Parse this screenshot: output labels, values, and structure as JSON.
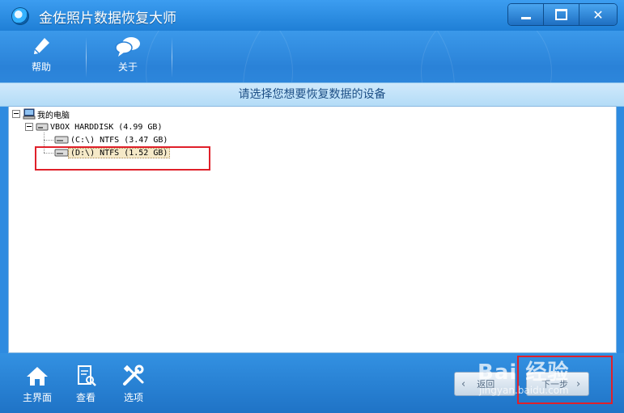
{
  "window": {
    "title": "金佐照片数据恢复大师",
    "controls": {
      "minimize": "minimize-button",
      "maximize": "maximize-button",
      "close": "✕"
    }
  },
  "toolbar": {
    "help_label": "帮助",
    "about_label": "关于"
  },
  "header": {
    "instruction": "请选择您想要恢复数据的设备"
  },
  "tree": {
    "root_label": "我的电脑",
    "disk_label": "VBOX HARDDISK (4.99 GB)",
    "partitions": [
      {
        "label": "(C:\\) NTFS (3.47 GB)"
      },
      {
        "label": "(D:\\) NTFS (1.52 GB)"
      }
    ]
  },
  "footer": {
    "home_label": "主界面",
    "view_label": "查看",
    "options_label": "选项",
    "back_label": "返回",
    "next_label": "下一步"
  },
  "watermark": {
    "brand": "Bai 经验",
    "url": "jingyan.baidu.com"
  },
  "colors": {
    "titlebar": "#2b8ee6",
    "accent": "#1f7fd6",
    "annotation": "#e0202a"
  }
}
